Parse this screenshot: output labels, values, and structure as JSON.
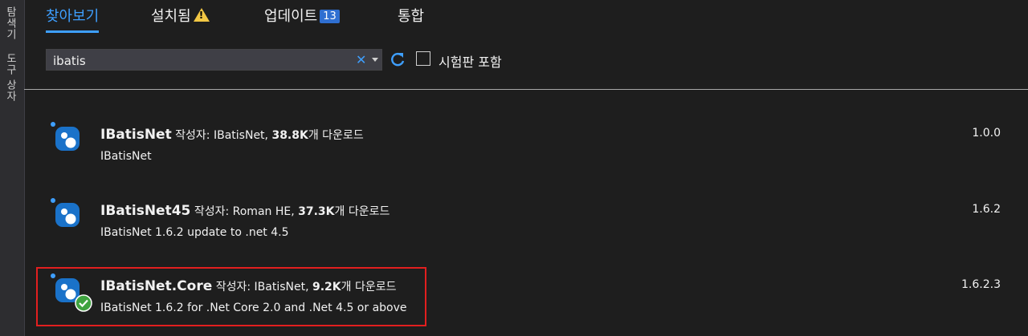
{
  "sidebar": {
    "tabs": [
      {
        "label": "탐색기"
      },
      {
        "label": "도구 상자"
      }
    ]
  },
  "tabs": [
    {
      "label": "찾아보기",
      "active": true
    },
    {
      "label": "설치됨",
      "icon": "warning-icon"
    },
    {
      "label": "업데이트",
      "badge": "13"
    },
    {
      "label": "통합"
    }
  ],
  "search": {
    "value": "ibatis",
    "clear_icon": "close-icon",
    "dropdown_icon": "chevron-down-icon",
    "refresh_icon": "refresh-icon",
    "prerelease_label": "시험판 포함",
    "prerelease_checked": false
  },
  "packages": [
    {
      "name": "IBatisNet",
      "author_label": "작성자: ",
      "author": "IBatisNet, ",
      "downloads": "38.8K",
      "downloads_suffix": "개 다운로드",
      "description": "IBatisNet",
      "version": "1.0.0",
      "installed": false
    },
    {
      "name": "IBatisNet45",
      "author_label": "작성자: ",
      "author": "Roman HE, ",
      "downloads": "37.3K",
      "downloads_suffix": "개 다운로드",
      "description": "IBatisNet 1.6.2 update to .net 4.5",
      "version": "1.6.2",
      "installed": false
    },
    {
      "name": "IBatisNet.Core",
      "author_label": "작성자: ",
      "author": "IBatisNet, ",
      "downloads": "9.2K",
      "downloads_suffix": "개 다운로드",
      "description": "IBatisNet 1.6.2 for .Net Core 2.0 and .Net 4.5 or above",
      "version": "1.6.2.3",
      "installed": true
    }
  ],
  "colors": {
    "accent": "#3e9fff",
    "background": "#1e1e1e",
    "highlight_border": "#e21f1f",
    "installed_check": "#3fa33f"
  }
}
